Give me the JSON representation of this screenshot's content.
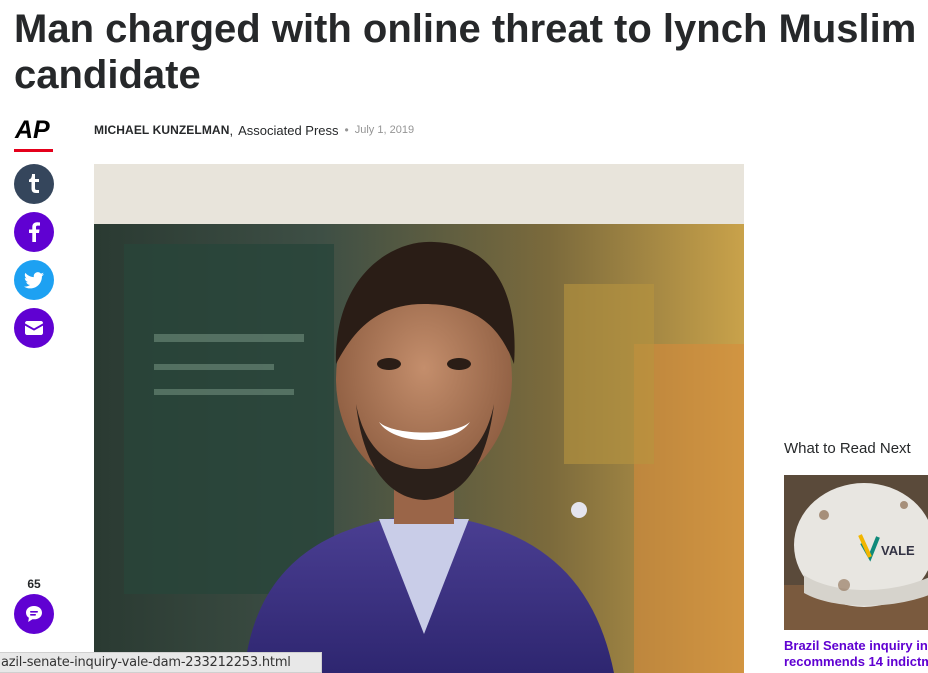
{
  "article": {
    "headline": "Man charged with online threat to lynch Muslim candidate",
    "author": "MICHAEL KUNZELMAN",
    "provider": "Associated Press",
    "date": "July 1, 2019",
    "publisher_logo_text": "AP"
  },
  "share": {
    "buttons": [
      {
        "name": "tumblr",
        "icon": "tumblr-icon",
        "color": "#35465c"
      },
      {
        "name": "facebook",
        "icon": "facebook-icon",
        "color": "#6001d2"
      },
      {
        "name": "twitter",
        "icon": "twitter-icon",
        "color": "#1da1f2"
      },
      {
        "name": "email",
        "icon": "email-icon",
        "color": "#6001d2"
      }
    ]
  },
  "comments": {
    "count": "65",
    "icon": "comment-icon",
    "color": "#6001d2"
  },
  "what_to_read_next": {
    "title": "What to Read Next",
    "items": [
      {
        "headline_line1": "Brazil Senate inquiry in",
        "headline_line2": "recommends 14 indictm",
        "thumbnail_text": "VALE"
      }
    ]
  },
  "status_bar": {
    "url": "azil-senate-inquiry-vale-dam-233212253.html"
  },
  "colors": {
    "accent": "#6001d2",
    "ap_red": "#e4001b",
    "headline": "#26282a"
  }
}
